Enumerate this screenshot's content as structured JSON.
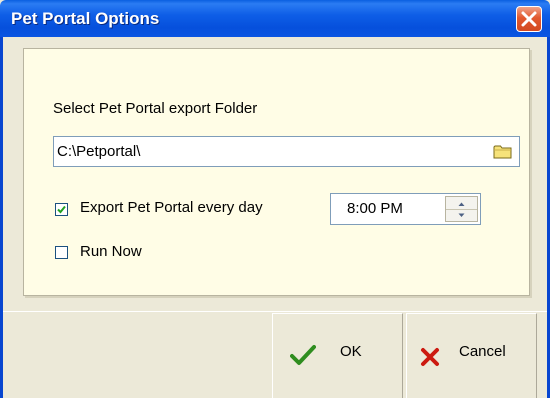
{
  "window": {
    "title": "Pet Portal Options",
    "close_icon": "close-icon"
  },
  "export": {
    "folder_label": "Select Pet Portal export Folder",
    "folder_path": "C:\\Petportal\\",
    "browse_icon": "folder-icon",
    "daily_export_label": "Export Pet Portal every day",
    "daily_export_checked": true,
    "time": "8:00 PM",
    "run_now_label": "Run Now",
    "run_now_checked": false
  },
  "buttons": {
    "ok_label": "OK",
    "ok_icon": "checkmark-icon",
    "cancel_label": "Cancel",
    "cancel_icon": "x-icon"
  },
  "colors": {
    "titlebar": "#0a55e2",
    "close_button": "#e2592f",
    "panel_background": "#fffde6",
    "dialog_background": "#ece9d8",
    "ok_check": "#2f8d1f",
    "cancel_x": "#cc1a10"
  }
}
